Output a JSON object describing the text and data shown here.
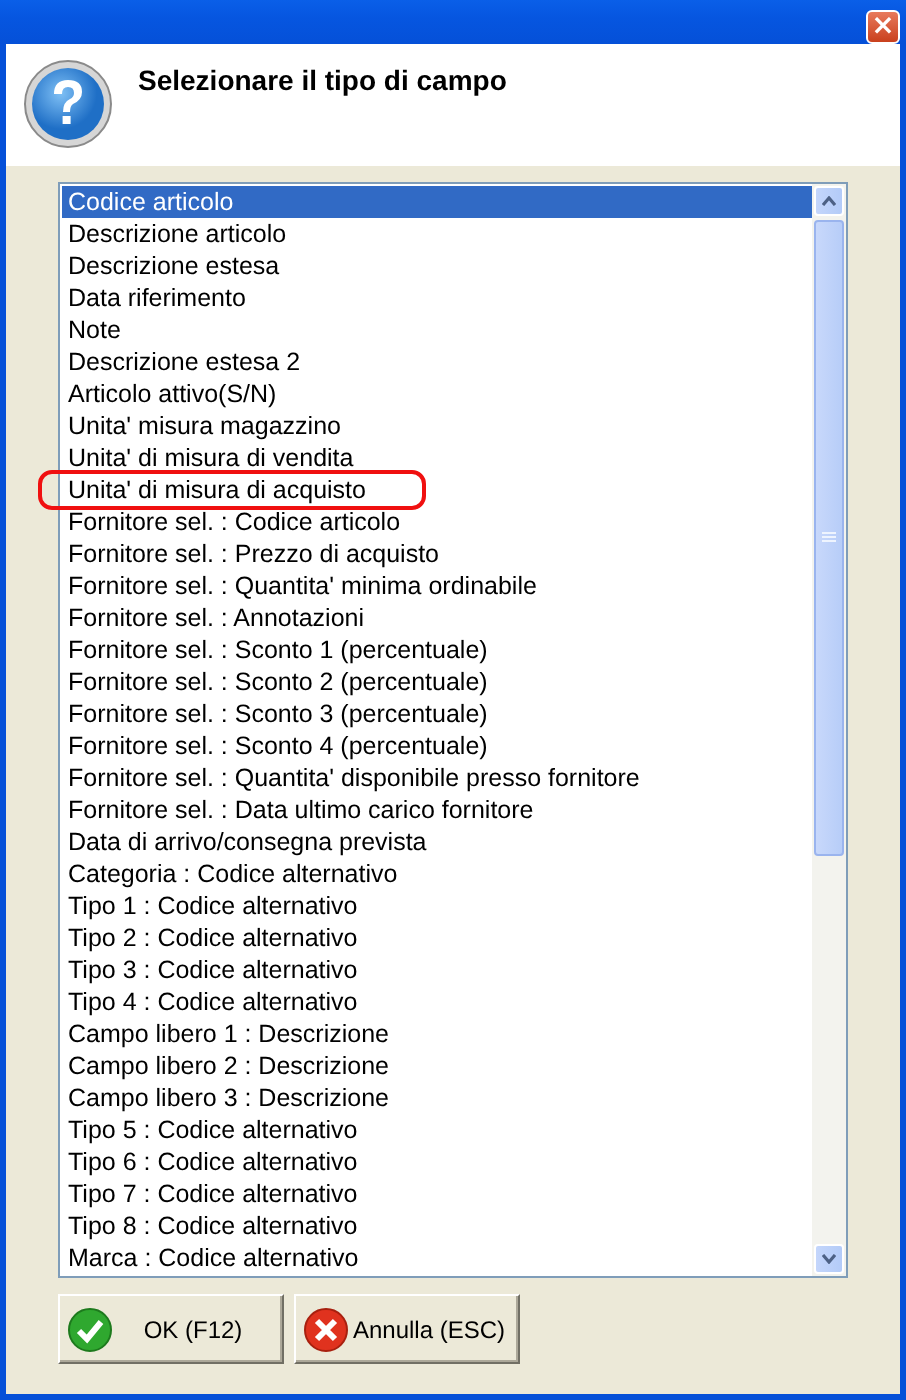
{
  "window": {
    "close_button": "×"
  },
  "header": {
    "title": "Selezionare il tipo di campo"
  },
  "list": {
    "items": [
      {
        "label": "Codice articolo",
        "selected": true,
        "circled": false
      },
      {
        "label": "Descrizione articolo",
        "selected": false,
        "circled": false
      },
      {
        "label": "Descrizione estesa",
        "selected": false,
        "circled": false
      },
      {
        "label": "Data riferimento",
        "selected": false,
        "circled": false
      },
      {
        "label": "Note",
        "selected": false,
        "circled": false
      },
      {
        "label": "Descrizione estesa 2",
        "selected": false,
        "circled": false
      },
      {
        "label": "Articolo attivo(S/N)",
        "selected": false,
        "circled": false
      },
      {
        "label": "Unita' misura magazzino",
        "selected": false,
        "circled": false
      },
      {
        "label": "Unita' di misura di vendita",
        "selected": false,
        "circled": false
      },
      {
        "label": "Unita' di misura di acquisto",
        "selected": false,
        "circled": true
      },
      {
        "label": "Fornitore sel. : Codice articolo",
        "selected": false,
        "circled": false
      },
      {
        "label": "Fornitore sel. : Prezzo di acquisto",
        "selected": false,
        "circled": false
      },
      {
        "label": "Fornitore sel. : Quantita' minima ordinabile",
        "selected": false,
        "circled": false
      },
      {
        "label": "Fornitore sel. : Annotazioni",
        "selected": false,
        "circled": false
      },
      {
        "label": "Fornitore sel. : Sconto 1 (percentuale)",
        "selected": false,
        "circled": false
      },
      {
        "label": "Fornitore sel. : Sconto 2 (percentuale)",
        "selected": false,
        "circled": false
      },
      {
        "label": "Fornitore sel. : Sconto 3 (percentuale)",
        "selected": false,
        "circled": false
      },
      {
        "label": "Fornitore sel. : Sconto 4 (percentuale)",
        "selected": false,
        "circled": false
      },
      {
        "label": "Fornitore sel. : Quantita' disponibile presso fornitore",
        "selected": false,
        "circled": false
      },
      {
        "label": "Fornitore sel. : Data ultimo carico fornitore",
        "selected": false,
        "circled": false
      },
      {
        "label": "Data di arrivo/consegna prevista",
        "selected": false,
        "circled": false
      },
      {
        "label": "Categoria : Codice alternativo",
        "selected": false,
        "circled": false
      },
      {
        "label": "Tipo 1 : Codice alternativo",
        "selected": false,
        "circled": false
      },
      {
        "label": "Tipo 2 : Codice alternativo",
        "selected": false,
        "circled": false
      },
      {
        "label": "Tipo 3 : Codice alternativo",
        "selected": false,
        "circled": false
      },
      {
        "label": "Tipo 4 : Codice alternativo",
        "selected": false,
        "circled": false
      },
      {
        "label": "Campo libero 1 : Descrizione",
        "selected": false,
        "circled": false
      },
      {
        "label": "Campo libero 2 : Descrizione",
        "selected": false,
        "circled": false
      },
      {
        "label": "Campo libero 3 : Descrizione",
        "selected": false,
        "circled": false
      },
      {
        "label": "Tipo 5 : Codice alternativo",
        "selected": false,
        "circled": false
      },
      {
        "label": "Tipo 6 : Codice alternativo",
        "selected": false,
        "circled": false
      },
      {
        "label": "Tipo 7 : Codice alternativo",
        "selected": false,
        "circled": false
      },
      {
        "label": "Tipo 8 : Codice alternativo",
        "selected": false,
        "circled": false
      },
      {
        "label": "Marca : Codice alternativo",
        "selected": false,
        "circled": false
      }
    ]
  },
  "buttons": [
    {
      "label": "OK (F12)",
      "kind": "ok"
    },
    {
      "label": "Annulla (ESC)",
      "kind": "cancel"
    }
  ]
}
